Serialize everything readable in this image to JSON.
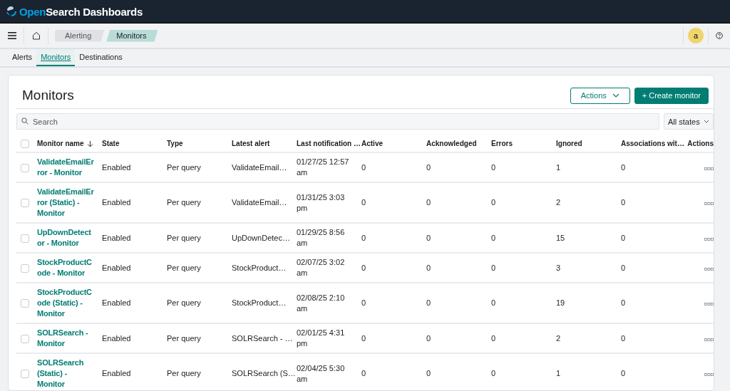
{
  "header": {
    "brand_prefix": "Open",
    "brand_rest": "Search Dashboards"
  },
  "breadcrumbs": [
    {
      "label": "Alerting",
      "selected": false
    },
    {
      "label": "Monitors",
      "selected": true
    }
  ],
  "user": {
    "initial": "a"
  },
  "tabs": [
    {
      "label": "Alerts",
      "selected": false
    },
    {
      "label": "Monitors",
      "selected": true
    },
    {
      "label": "Destinations",
      "selected": false
    }
  ],
  "panel": {
    "title": "Monitors",
    "actions_button": "Actions",
    "create_button": "+ Create monitor"
  },
  "search": {
    "placeholder": "Search"
  },
  "state_filter": {
    "value": "All states"
  },
  "table": {
    "select_all": {
      "checked": false
    },
    "columns": [
      "Monitor name",
      "State",
      "Type",
      "Latest alert",
      "Last notification …",
      "Active",
      "Acknowledged",
      "Errors",
      "Ignored",
      "Associations wit…",
      "Actions"
    ],
    "rows": [
      {
        "checked": false,
        "name": "ValidateEmailError - Monitor",
        "state": "Enabled",
        "type": "Per query",
        "latest_alert": "ValidateEmail…",
        "last_notification": "01/27/25 12:57 am",
        "active": "0",
        "acknowledged": "0",
        "errors": "0",
        "ignored": "1",
        "associations": "0"
      },
      {
        "checked": false,
        "name": "ValidateEmailError (Static) - Monitor",
        "state": "Enabled",
        "type": "Per query",
        "latest_alert": "ValidateEmail…",
        "last_notification": "01/31/25 3:03 pm",
        "active": "0",
        "acknowledged": "0",
        "errors": "0",
        "ignored": "2",
        "associations": "0"
      },
      {
        "checked": false,
        "name": "UpDownDetector - Monitor",
        "state": "Enabled",
        "type": "Per query",
        "latest_alert": "UpDownDetec…",
        "last_notification": "01/29/25 8:56 am",
        "active": "0",
        "acknowledged": "0",
        "errors": "0",
        "ignored": "15",
        "associations": "0"
      },
      {
        "checked": false,
        "name": "StockProductCode - Monitor",
        "state": "Enabled",
        "type": "Per query",
        "latest_alert": "StockProduct…",
        "last_notification": "02/07/25 3:02 am",
        "active": "0",
        "acknowledged": "0",
        "errors": "0",
        "ignored": "3",
        "associations": "0"
      },
      {
        "checked": false,
        "name": "StockProductCode (Static) - Monitor",
        "state": "Enabled",
        "type": "Per query",
        "latest_alert": "StockProduct…",
        "last_notification": "02/08/25 2:10 am",
        "active": "0",
        "acknowledged": "0",
        "errors": "0",
        "ignored": "19",
        "associations": "0"
      },
      {
        "checked": false,
        "name": "SOLRSearch - Monitor",
        "state": "Enabled",
        "type": "Per query",
        "latest_alert": "SOLRSearch - …",
        "last_notification": "02/01/25 4:31 pm",
        "active": "0",
        "acknowledged": "0",
        "errors": "0",
        "ignored": "2",
        "associations": "0"
      },
      {
        "checked": false,
        "name": "SOLRSearch (Static) - Monitor",
        "state": "Enabled",
        "type": "Per query",
        "latest_alert": "SOLRSearch (S…",
        "last_notification": "02/04/25 5:30 am",
        "active": "0",
        "acknowledged": "0",
        "errors": "0",
        "ignored": "1",
        "associations": "0"
      }
    ]
  }
}
